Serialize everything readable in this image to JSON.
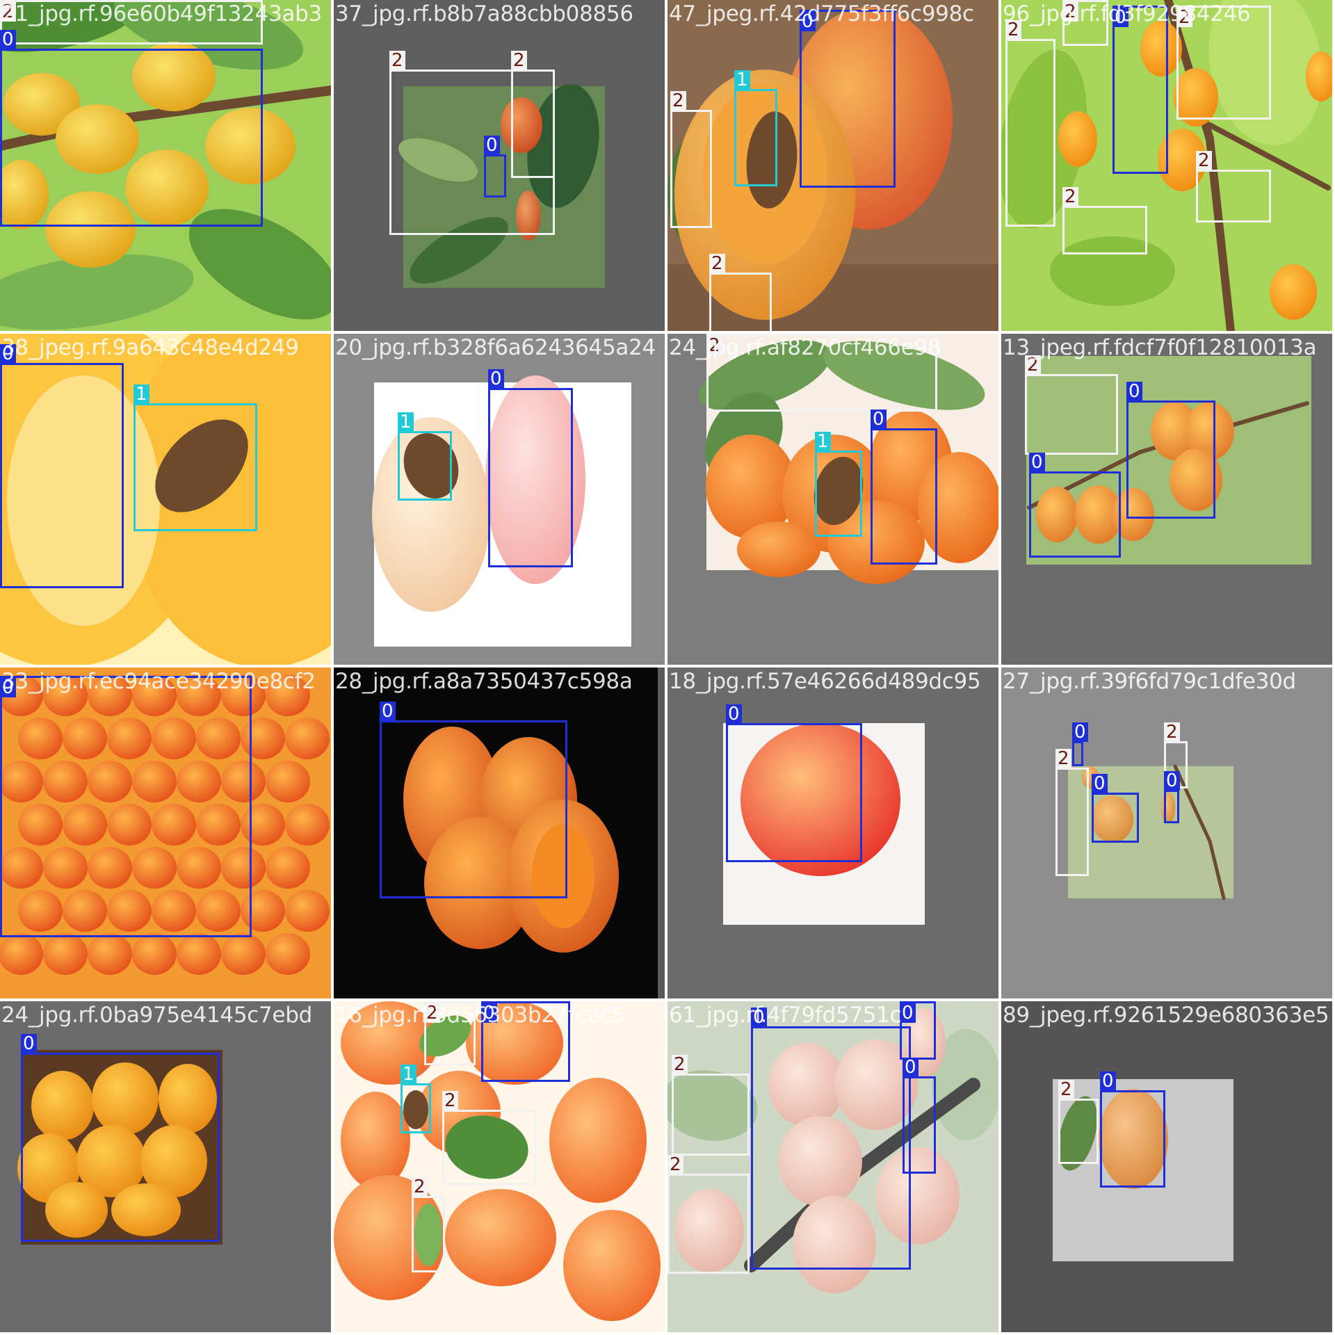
{
  "grid": {
    "rows": 4,
    "cols": 4
  },
  "legend": {
    "class_colors": {
      "0": "#1f2fd8",
      "1": "#22c9d6",
      "2": "#f2f2f2"
    },
    "tag_text_colors": {
      "0": "#ffffff",
      "1": "#ffffff",
      "2": "#6b1a12"
    }
  },
  "tiles": [
    {
      "title": "21_jpg.rf.96e60b49f13243ab3",
      "scene": "branch-yellow",
      "labels": [
        "2",
        "0"
      ]
    },
    {
      "title": "37_jpg.rf.b8b7a88cbb08856",
      "scene": "gray-inset-leaves",
      "labels": [
        "2",
        "2",
        "0"
      ]
    },
    {
      "title": "47_jpeg.rf.42d775f3ff6c998c",
      "scene": "cut-apricot",
      "labels": [
        "0",
        "1",
        "2",
        "2"
      ]
    },
    {
      "title": "96_jpg.rf.fd3f92984246",
      "scene": "tree-green",
      "labels": [
        "2",
        "2",
        "0",
        "2",
        "2",
        "2"
      ]
    },
    {
      "title": "38_jpeg.rf.9a643c48e4d249",
      "scene": "pit-closeup",
      "labels": [
        "0",
        "1"
      ]
    },
    {
      "title": "20_jpg.rf.b328f6a6243645a24",
      "scene": "white-halves",
      "labels": [
        "1",
        "0"
      ]
    },
    {
      "title": "24_jpg.rf.af8270cf466e98",
      "scene": "orange-pile",
      "labels": [
        "2",
        "0",
        "1"
      ]
    },
    {
      "title": "13_jpeg.rf.fdcf7f0f12810013a",
      "scene": "gray-tree-inset",
      "labels": [
        "2",
        "0",
        "0"
      ]
    },
    {
      "title": "33_jpg.rf.ec94ace34290e8cf2",
      "scene": "many-apricots",
      "labels": [
        "0"
      ]
    },
    {
      "title": "28_jpg.rf.a8a7350437c598a",
      "scene": "black-bg",
      "labels": [
        "0"
      ]
    },
    {
      "title": "18_jpg.rf.57e46266d489dc95",
      "scene": "single-red",
      "labels": [
        "0"
      ]
    },
    {
      "title": "27_jpg.rf.39f6fd79c1dfe30d",
      "scene": "small-inset",
      "labels": [
        "0",
        "2",
        "2",
        "0",
        "0"
      ]
    },
    {
      "title": "24_jpg.rf.0ba975e4145c7ebd",
      "scene": "basket-pile",
      "labels": [
        "0"
      ]
    },
    {
      "title": "16_jpg.rf.3d56303b27fcac5",
      "scene": "bright-mixed",
      "labels": [
        "2",
        "0",
        "1",
        "2",
        "2"
      ]
    },
    {
      "title": "61_jpg.rf.4f79fd5751c",
      "scene": "pale-branch",
      "labels": [
        "0",
        "0",
        "2",
        "2",
        "0"
      ]
    },
    {
      "title": "89_jpeg.rf.9261529e680363e5",
      "scene": "checker-single",
      "labels": [
        "2",
        "0"
      ]
    }
  ]
}
